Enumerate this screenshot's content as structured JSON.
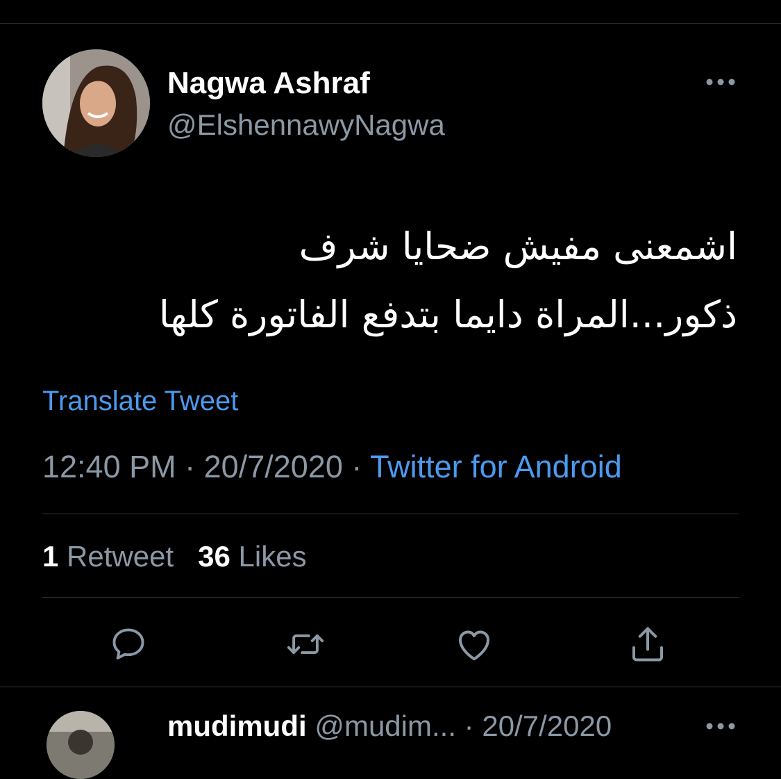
{
  "tweet": {
    "author": {
      "display_name": "Nagwa Ashraf",
      "handle": "@ElshennawyNagwa",
      "avatar_icon": "avatar-photo"
    },
    "more_icon": "more-horizontal-icon",
    "text_lines": [
      "اشمعنى مفيش ضحايا شرف",
      "ذكور...المراة  دايما بتدفع الفاتورة كلها"
    ],
    "translate_label": "Translate Tweet",
    "meta": {
      "time": "12:40 PM",
      "separator": "·",
      "date": "20/7/2020",
      "source": "Twitter for Android"
    },
    "stats": {
      "retweet_count": "1",
      "retweet_label": "Retweet",
      "like_count": "36",
      "like_label": "Likes"
    },
    "actions": [
      {
        "name": "reply",
        "icon": "reply-icon"
      },
      {
        "name": "retweet",
        "icon": "retweet-icon"
      },
      {
        "name": "like",
        "icon": "heart-icon"
      },
      {
        "name": "share",
        "icon": "share-icon"
      }
    ]
  },
  "reply": {
    "display_name": "mudimudi",
    "handle": "@mudim...",
    "separator": "·",
    "date": "20/7/2020"
  },
  "colors": {
    "background": "#000000",
    "divider": "#2f3336",
    "secondary_text": "#8b98a5",
    "link": "#4c9aee",
    "primary_text": "#ffffff"
  }
}
